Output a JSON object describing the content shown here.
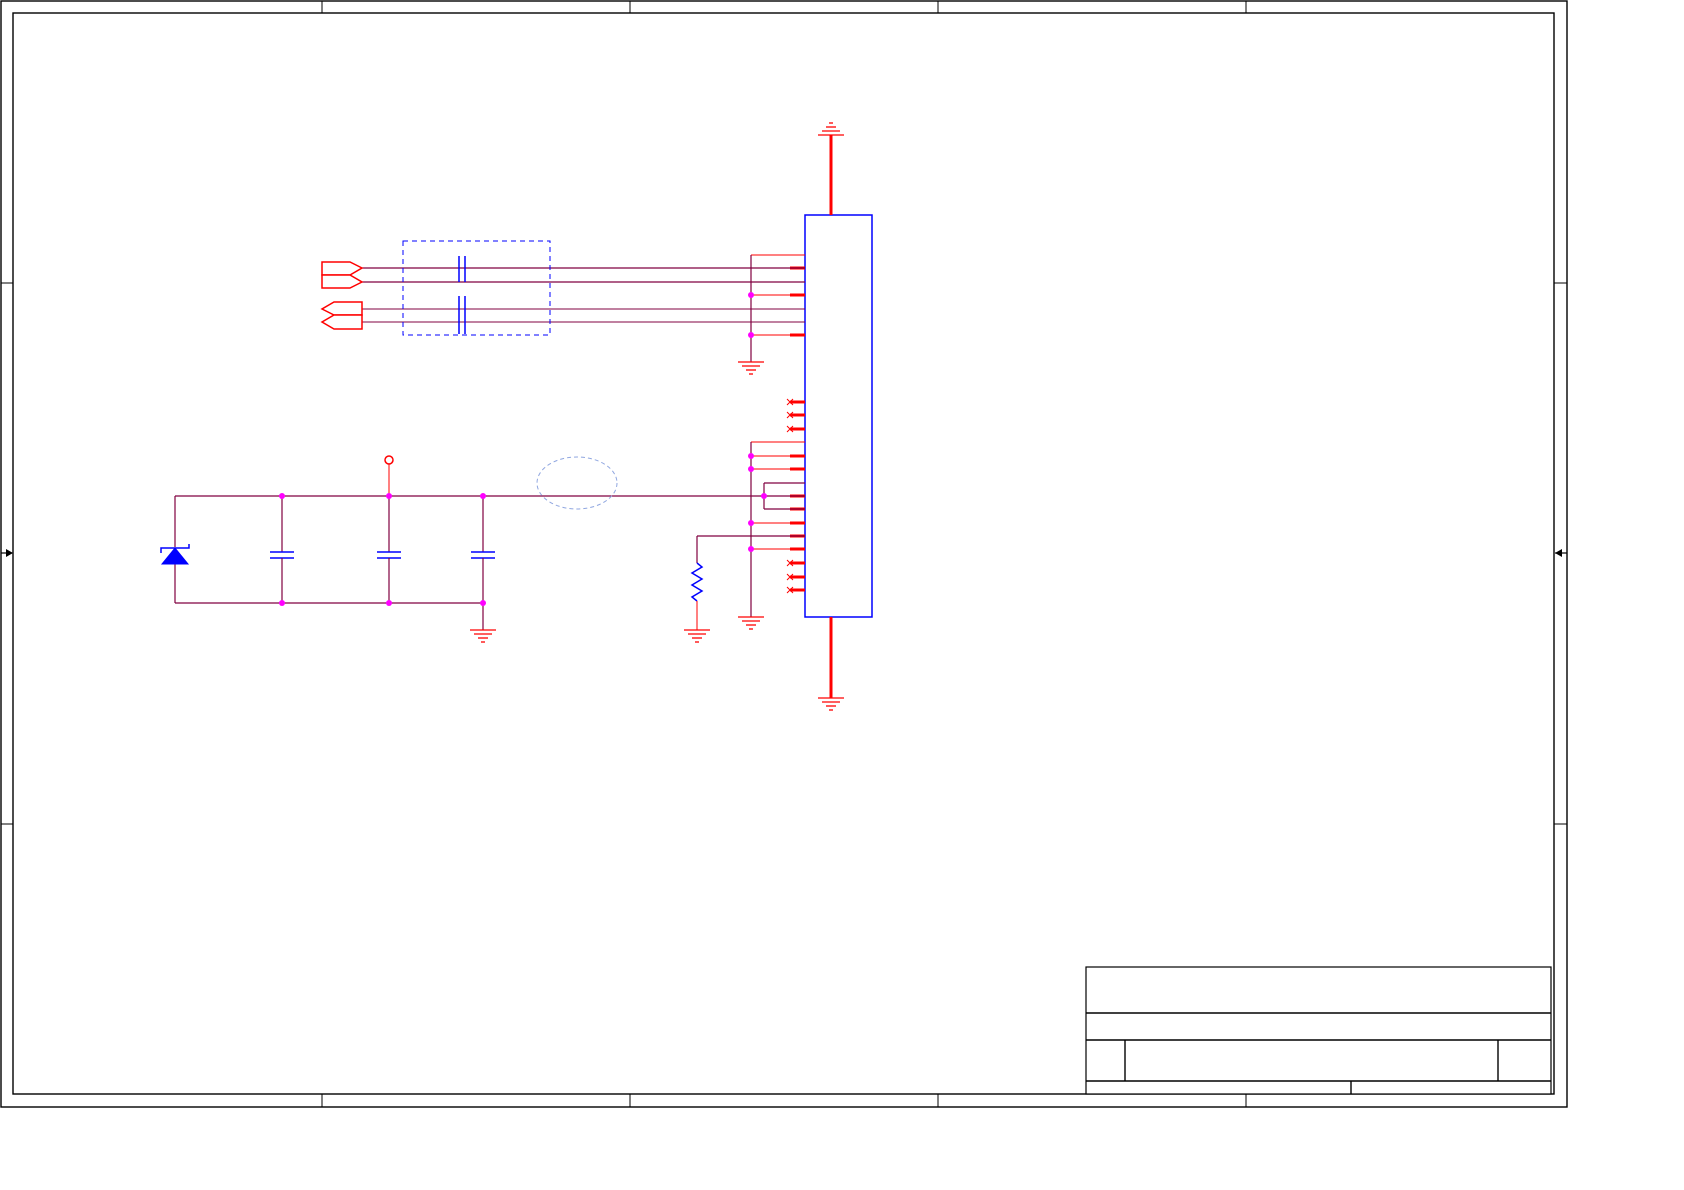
{
  "schematic": {
    "theme": {
      "frame": "#000000",
      "wire": "#ff0000",
      "net": "#800040",
      "component": "#0000ff",
      "junction": "#ff00ff",
      "annotation": "#8fa6e0",
      "background": "#ffffff"
    },
    "symbols": [
      "ground-symbol",
      "power-flag-symbol",
      "capacitor-symbol",
      "resistor-symbol",
      "zener-diode-symbol",
      "connector-symbol",
      "no-connect-symbol",
      "port-symbol"
    ],
    "title_block": {
      "title": "",
      "subtitle": "",
      "size": "",
      "document_number": "",
      "revision": "",
      "date": "",
      "sheet": ""
    }
  }
}
